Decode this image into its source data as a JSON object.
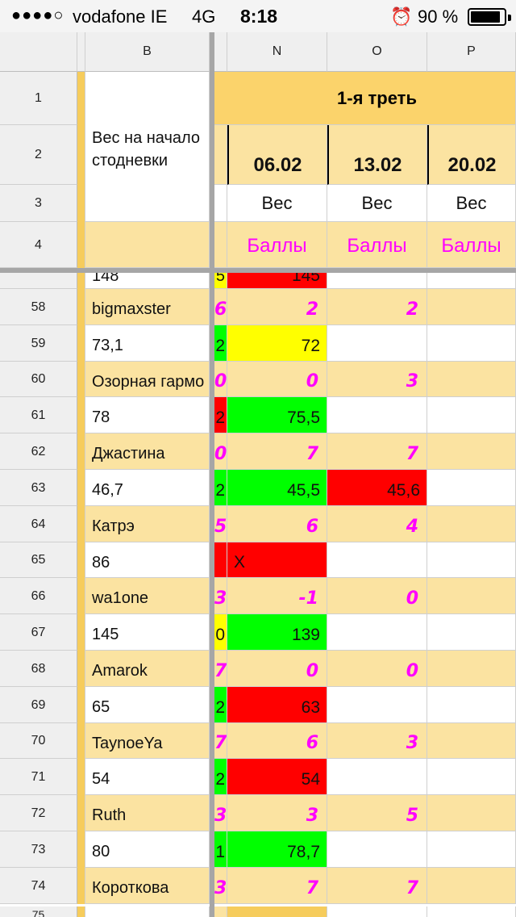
{
  "status": {
    "signal": "●●●●○",
    "carrier": "vodafone IE",
    "network": "4G",
    "time": "8:18",
    "alarm_icon": "⏰",
    "battery": "90 %"
  },
  "columns": {
    "b": "B",
    "n": "N",
    "o": "O",
    "p": "P"
  },
  "header_rows": {
    "r1": "1",
    "r2": "2",
    "r3": "3",
    "r4": "4",
    "b_title": "Вес на начало стодневки",
    "third": "1-я треть",
    "dates": [
      "06.02",
      "13.02",
      "20.02"
    ],
    "weight_label": "Вес",
    "points_label": "Баллы"
  },
  "partial_top": {
    "b": "148",
    "left": "5",
    "n": "145"
  },
  "rows": [
    {
      "num": "58",
      "type": "name",
      "b": "bigmaxster",
      "left": "6",
      "n": "2",
      "o": "2",
      "p": "",
      "left_color": "",
      "n_color": "",
      "o_color": ""
    },
    {
      "num": "59",
      "type": "weight",
      "b": "73,1",
      "left": "2",
      "n": "72",
      "o": "",
      "p": "",
      "left_color": "#00ff00",
      "n_color": "#ffff00",
      "o_color": ""
    },
    {
      "num": "60",
      "type": "name",
      "b": "Озорная гармо",
      "left": "0",
      "n": "0",
      "o": "3",
      "p": "",
      "left_color": "",
      "n_color": "",
      "o_color": ""
    },
    {
      "num": "61",
      "type": "weight",
      "b": "78",
      "left": "2",
      "n": "75,5",
      "o": "",
      "p": "",
      "left_color": "#ff0000",
      "n_color": "#00ff00",
      "o_color": ""
    },
    {
      "num": "62",
      "type": "name",
      "b": "Джастина",
      "left": "0",
      "n": "7",
      "o": "7",
      "p": "",
      "left_color": "",
      "n_color": "",
      "o_color": ""
    },
    {
      "num": "63",
      "type": "weight",
      "b": "46,7",
      "left": "2",
      "n": "45,5",
      "o": "45,6",
      "p": "",
      "left_color": "#00ff00",
      "n_color": "#00ff00",
      "o_color": "#ff0000"
    },
    {
      "num": "64",
      "type": "name",
      "b": "Катрэ",
      "left": "5",
      "n": "6",
      "o": "4",
      "p": "",
      "left_color": "",
      "n_color": "",
      "o_color": ""
    },
    {
      "num": "65",
      "type": "weight",
      "b": "86",
      "left": "",
      "n": "X",
      "o": "",
      "p": "",
      "left_color": "#ff0000",
      "n_color": "#ff0000",
      "o_color": ""
    },
    {
      "num": "66",
      "type": "name",
      "b": "wa1one",
      "left": "3",
      "n": "-1",
      "o": "0",
      "p": "",
      "left_color": "",
      "n_color": "",
      "o_color": ""
    },
    {
      "num": "67",
      "type": "weight",
      "b": "145",
      "left": "0",
      "n": "139",
      "o": "",
      "p": "",
      "left_color": "#ffff00",
      "n_color": "#00ff00",
      "o_color": ""
    },
    {
      "num": "68",
      "type": "name",
      "b": "Amarok",
      "left": "7",
      "n": "0",
      "o": "0",
      "p": "",
      "left_color": "",
      "n_color": "",
      "o_color": ""
    },
    {
      "num": "69",
      "type": "weight",
      "b": "65",
      "left": "2",
      "n": "63",
      "o": "",
      "p": "",
      "left_color": "#00ff00",
      "n_color": "#ff0000",
      "o_color": ""
    },
    {
      "num": "70",
      "type": "name",
      "b": "TaynoeYa",
      "left": "7",
      "n": "6",
      "o": "3",
      "p": "",
      "left_color": "",
      "n_color": "",
      "o_color": ""
    },
    {
      "num": "71",
      "type": "weight",
      "b": "54",
      "left": "2",
      "n": "54",
      "o": "",
      "p": "",
      "left_color": "#00ff00",
      "n_color": "#ff0000",
      "o_color": ""
    },
    {
      "num": "72",
      "type": "name",
      "b": "Ruth",
      "left": "3",
      "n": "3",
      "o": "5",
      "p": "",
      "left_color": "",
      "n_color": "",
      "o_color": ""
    },
    {
      "num": "73",
      "type": "weight",
      "b": "80",
      "left": "1",
      "n": "78,7",
      "o": "",
      "p": "",
      "left_color": "#00ff00",
      "n_color": "#00ff00",
      "o_color": ""
    },
    {
      "num": "74",
      "type": "name",
      "b": "Короткова",
      "left": "3",
      "n": "7",
      "o": "7",
      "p": "",
      "left_color": "",
      "n_color": "",
      "o_color": ""
    }
  ],
  "partial_bottom": {
    "num": "75"
  }
}
